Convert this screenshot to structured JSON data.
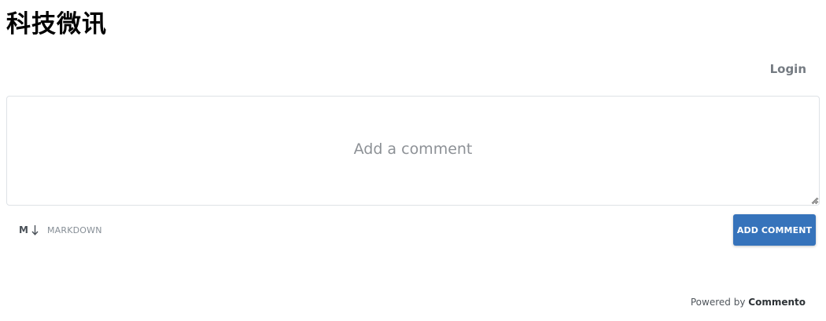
{
  "page": {
    "title": "科技微讯"
  },
  "header": {
    "login_label": "Login"
  },
  "comment_form": {
    "placeholder": "Add a comment",
    "markdown_icon_letter": "M",
    "markdown_label": "MARKDOWN",
    "submit_label": "ADD COMMENT",
    "accent_color": "#3673bb"
  },
  "footer": {
    "powered_by_prefix": "Powered by",
    "brand": "Commento"
  }
}
